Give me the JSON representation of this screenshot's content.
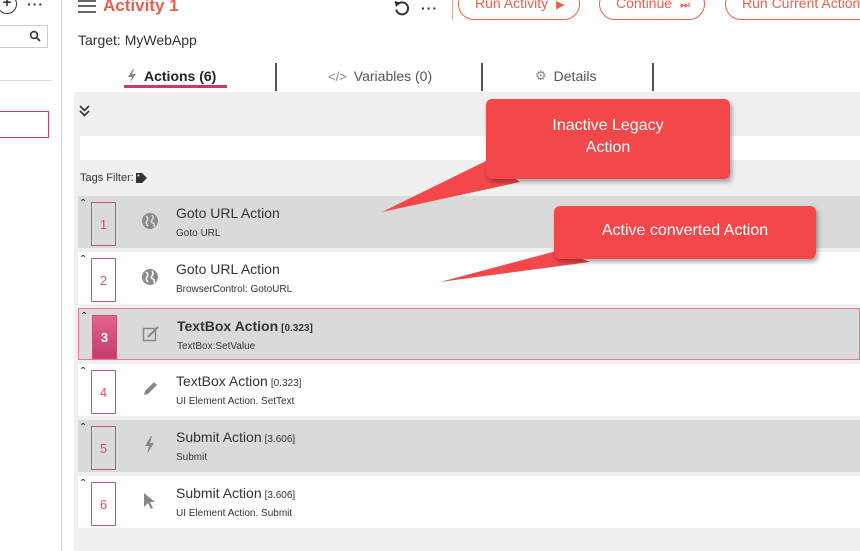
{
  "header": {
    "title": "Activity 1",
    "target_label": "Target: MyWebApp",
    "buttons": {
      "run_activity": "Run Activity",
      "continue": "Continue",
      "run_current": "Run Current Action"
    }
  },
  "tabs": [
    {
      "label": "Actions (6)",
      "icon": "bolt-icon"
    },
    {
      "label": "Variables (0)",
      "icon": "code-icon"
    },
    {
      "label": "Details",
      "icon": "gear-icon"
    }
  ],
  "tags_filter_label": "Tags Filter:",
  "actions": [
    {
      "number": "1",
      "title": "Goto URL Action",
      "badge": "",
      "subtitle": "Goto URL",
      "state": "inactive",
      "icon": "globe-icon"
    },
    {
      "number": "2",
      "title": "Goto URL Action",
      "badge": "",
      "subtitle": "BrowserControl: GotoURL",
      "state": "active",
      "icon": "globe-icon"
    },
    {
      "number": "3",
      "title": "TextBox Action",
      "badge": "[0.323]",
      "subtitle": "TextBox:SetValue",
      "state": "selected",
      "icon": "edit-box-icon"
    },
    {
      "number": "4",
      "title": "TextBox Action",
      "badge": "[0.323]",
      "subtitle": "UI Element Action. SetText",
      "state": "active",
      "icon": "pencil-icon"
    },
    {
      "number": "5",
      "title": "Submit Action",
      "badge": "[3.606]",
      "subtitle": "Submit",
      "state": "inactive",
      "icon": "bolt-icon"
    },
    {
      "number": "6",
      "title": "Submit Action",
      "badge": "[3.606]",
      "subtitle": "UI Element Action. Submit",
      "state": "active",
      "icon": "cursor-icon"
    }
  ],
  "callouts": {
    "inactive": "Inactive Legacy Action",
    "active": "Active converted Action"
  },
  "colors": {
    "accent": "#e8604c",
    "selection": "#c93a6a",
    "callout": "#f4474a"
  }
}
